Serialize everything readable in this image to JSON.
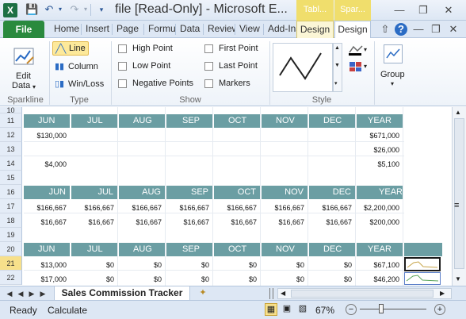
{
  "window": {
    "title": "file  [Read-Only]  -  Microsoft E...",
    "context_groups": [
      "Tabl...",
      "Spar..."
    ]
  },
  "ribbon_tabs": {
    "file": "File",
    "home": "Home",
    "insert": "Insert",
    "page_layout": "Page",
    "formulas": "Formulas",
    "data": "Data",
    "review": "Review",
    "view": "View",
    "addins": "Add-Ins",
    "design1": "Design",
    "design2": "Design"
  },
  "ribbon": {
    "sparkline": {
      "edit_data": "Edit",
      "edit_data2": "Data",
      "group_label": "Sparkline"
    },
    "type": {
      "line": "Line",
      "column": "Column",
      "winloss": "Win/Loss",
      "group_label": "Type"
    },
    "show": {
      "high_point": "High Point",
      "low_point": "Low Point",
      "negative_points": "Negative Points",
      "first_point": "First Point",
      "last_point": "Last Point",
      "markers": "Markers",
      "group_label": "Show"
    },
    "style": {
      "group_label": "Style"
    },
    "group": {
      "label": "Group"
    }
  },
  "rows": [
    {
      "num": "10"
    },
    {
      "num": "11"
    },
    {
      "num": "12"
    },
    {
      "num": "13"
    },
    {
      "num": "14"
    },
    {
      "num": "15"
    },
    {
      "num": "16"
    },
    {
      "num": "17"
    },
    {
      "num": "18"
    },
    {
      "num": "19"
    },
    {
      "num": "20"
    },
    {
      "num": "21"
    },
    {
      "num": "22"
    }
  ],
  "table1": {
    "headers": [
      "JUN",
      "JUL",
      "AUG",
      "SEP",
      "OCT",
      "NOV",
      "DEC",
      "YEAR"
    ],
    "row12": {
      "jun": "$130,000",
      "year": "$671,000"
    },
    "row13": {
      "year": "$26,000"
    },
    "row14": {
      "jun": "$4,000",
      "year": "$5,100"
    }
  },
  "table2": {
    "headers": [
      "JUN",
      "JUL",
      "AUG",
      "SEP",
      "OCT",
      "NOV",
      "DEC",
      "YEAR"
    ],
    "row17": [
      "$166,667",
      "$166,667",
      "$166,667",
      "$166,667",
      "$166,667",
      "$166,667",
      "$166,667",
      "$2,200,000"
    ],
    "row18": [
      "$16,667",
      "$16,667",
      "$16,667",
      "$16,667",
      "$16,667",
      "$16,667",
      "$16,667",
      "$200,000"
    ]
  },
  "table3": {
    "headers": [
      "JUN",
      "JUL",
      "AUG",
      "SEP",
      "OCT",
      "NOV",
      "DEC",
      "YEAR"
    ],
    "row21": [
      "$13,000",
      "$0",
      "$0",
      "$0",
      "$0",
      "$0",
      "$0",
      "$67,100"
    ],
    "row22": [
      "$17,000",
      "$0",
      "$0",
      "$0",
      "$0",
      "$0",
      "$0",
      "$46,200"
    ]
  },
  "sheet_tab": "Sales Commission Tracker",
  "status": {
    "ready": "Ready",
    "calculate": "Calculate",
    "zoom": "67%"
  },
  "colors": {
    "header_teal": "#6b9ea3",
    "file_green": "#2a8a3e",
    "context_gold": "#f0de6c"
  }
}
